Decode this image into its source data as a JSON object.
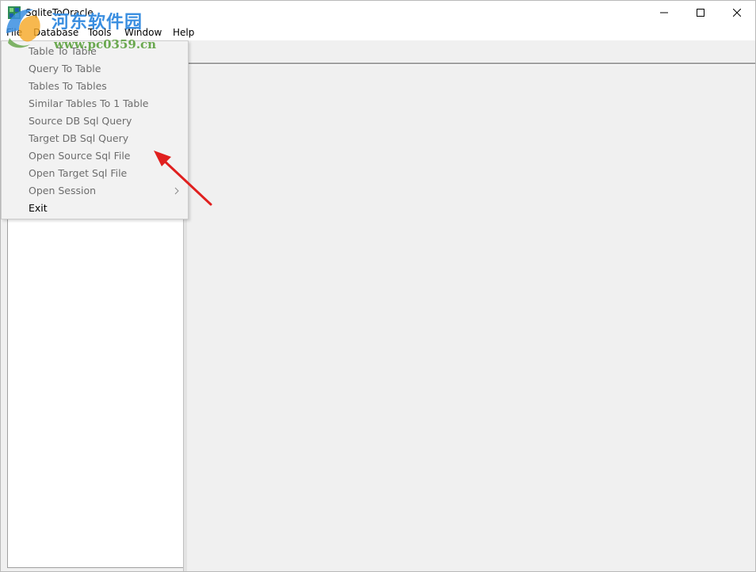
{
  "window": {
    "title": "SqliteToOracle"
  },
  "menubar": {
    "items": [
      "File",
      "Database",
      "Tools",
      "Window",
      "Help"
    ]
  },
  "file_menu": {
    "items": [
      {
        "label": "Table To Table",
        "enabled": false
      },
      {
        "label": "Query To Table",
        "enabled": false
      },
      {
        "label": "Tables To Tables",
        "enabled": false
      },
      {
        "label": "Similar Tables To 1 Table",
        "enabled": false
      },
      {
        "label": "Source DB Sql Query",
        "enabled": false
      },
      {
        "label": "Target DB Sql Query",
        "enabled": false
      },
      {
        "label": "Open Source Sql File",
        "enabled": false
      },
      {
        "label": "Open Target Sql File",
        "enabled": false
      },
      {
        "label": "Open Session",
        "enabled": false,
        "has_submenu": true
      },
      {
        "label": "Exit",
        "enabled": true
      }
    ]
  },
  "watermark": {
    "site_name": "河东软件园",
    "url": "www.pc0359.cn"
  },
  "icons": {
    "app": "app-icon",
    "minimize": "minimize-icon",
    "maximize": "maximize-icon",
    "close": "close-icon",
    "submenu": "chevron-right-icon",
    "annotation": "red-arrow-icon"
  },
  "colors": {
    "annotation_arrow": "#e0201f",
    "watermark_blue": "#3a8ee0",
    "watermark_green": "#6aa84f",
    "disabled_text": "#6d6d6d"
  }
}
